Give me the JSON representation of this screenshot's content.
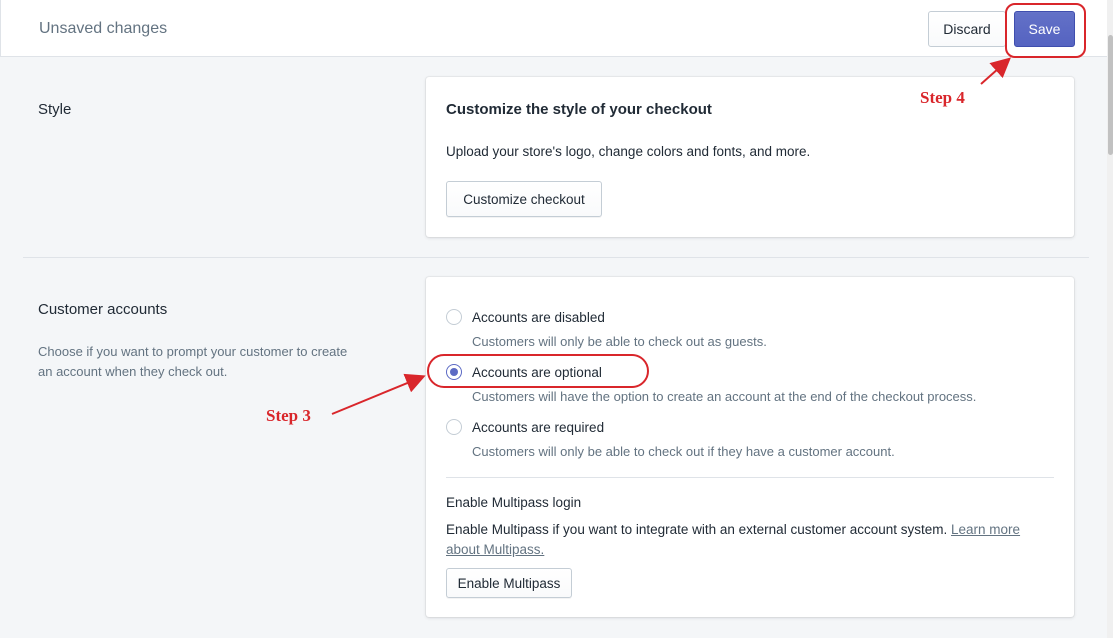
{
  "topbar": {
    "title": "Unsaved changes",
    "discard_label": "Discard",
    "save_label": "Save"
  },
  "style_section": {
    "title": "Style",
    "card_heading": "Customize the style of your checkout",
    "card_text": "Upload your store's logo, change colors and fonts, and more.",
    "button_label": "Customize checkout"
  },
  "accounts_section": {
    "title": "Customer accounts",
    "description": "Choose if you want to prompt your customer to create an account when they check out.",
    "options": [
      {
        "label": "Accounts are disabled",
        "help": "Customers will only be able to check out as guests.",
        "checked": false
      },
      {
        "label": "Accounts are optional",
        "help": "Customers will have the option to create an account at the end of the checkout process.",
        "checked": true
      },
      {
        "label": "Accounts are required",
        "help": "Customers will only be able to check out if they have a customer account.",
        "checked": false
      }
    ],
    "multipass": {
      "heading": "Enable Multipass login",
      "text": "Enable Multipass if you want to integrate with an external customer account system.",
      "link_text_1": "Learn more",
      "link_text_2": "about Multipass.",
      "button_label": "Enable Multipass"
    }
  },
  "annotations": {
    "step3": "Step 3",
    "step4": "Step 4"
  },
  "colors": {
    "accent": "#5c6ac4",
    "annotation": "#d9262b"
  }
}
